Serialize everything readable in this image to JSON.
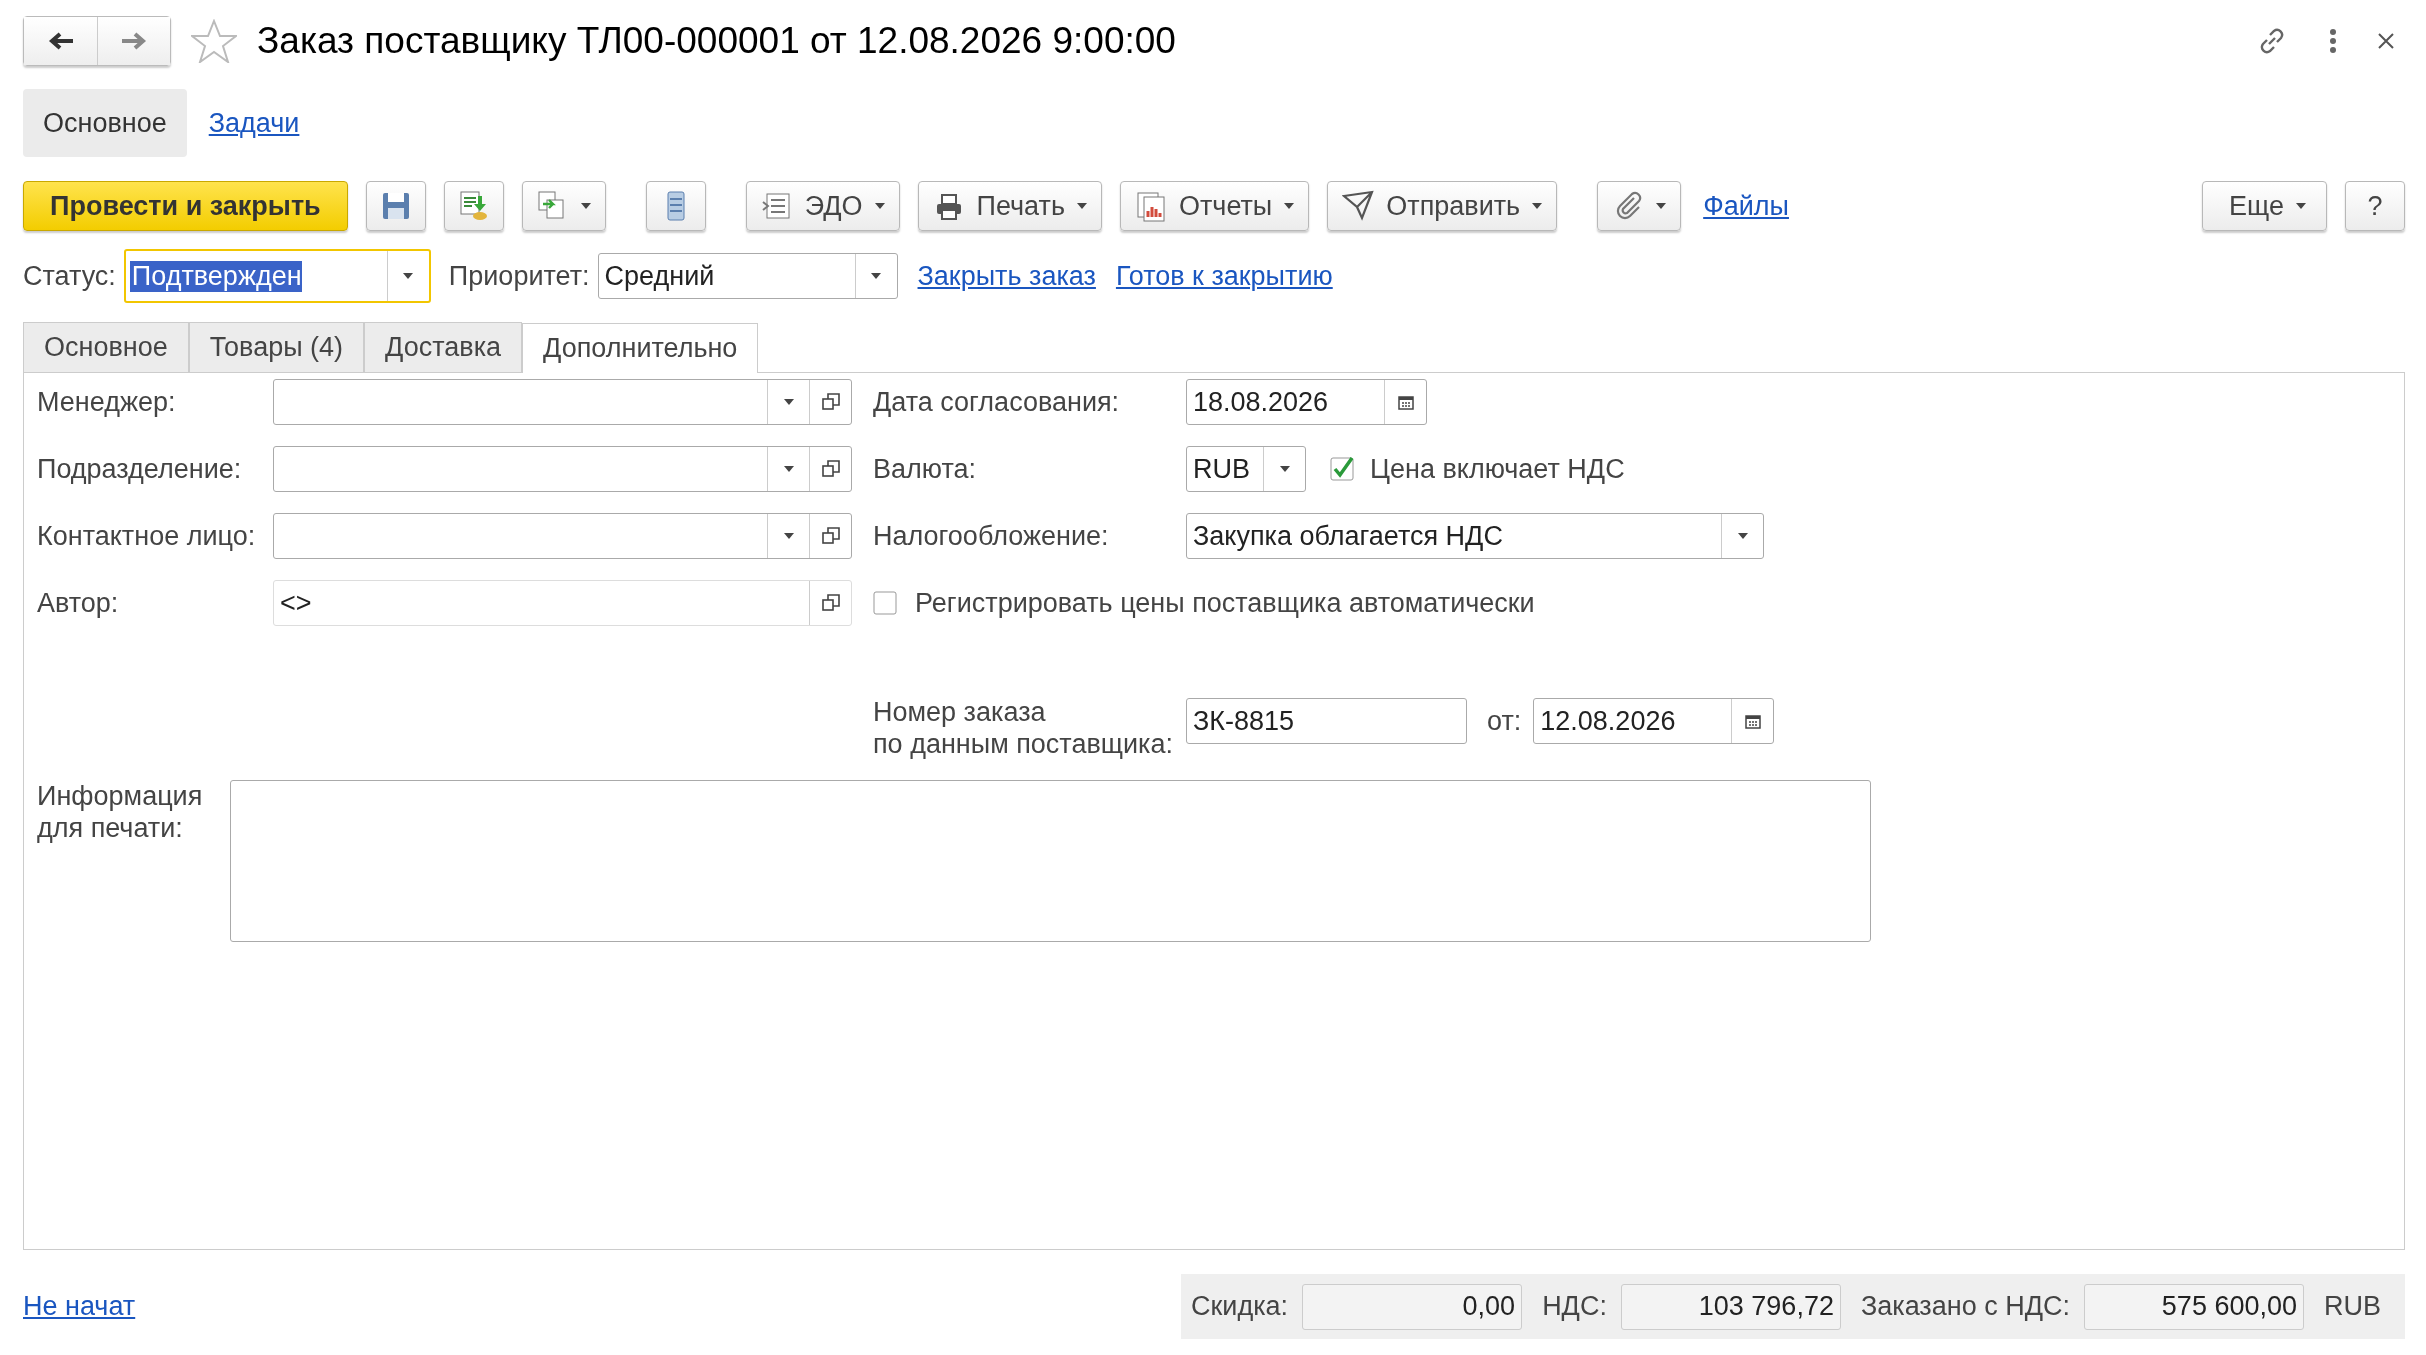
{
  "window": {
    "title": "Заказ поставщику ТЛ00-000001 от 12.08.2026 9:00:00",
    "favorite": false
  },
  "sections": [
    {
      "label": "Основное",
      "selected": true
    },
    {
      "label": "Задачи",
      "selected": false
    }
  ],
  "toolbar": [
    {
      "kind": "primary",
      "label": "Провести и закрыть"
    },
    {
      "kind": "icon"
    },
    {
      "kind": "icon"
    },
    {
      "kind": "icon-menu"
    },
    {
      "kind": "icon",
      "gap": true
    },
    {
      "kind": "menu",
      "label": "ЭДО",
      "gap": true
    },
    {
      "kind": "menu",
      "label": "Печать"
    },
    {
      "kind": "menu",
      "label": "Отчеты"
    },
    {
      "kind": "menu",
      "label": "Отправить"
    },
    {
      "kind": "icon-menu",
      "gap": true
    },
    {
      "kind": "link",
      "label": "Файлы"
    },
    {
      "kind": "menu",
      "label": "Еще",
      "right": true
    },
    {
      "kind": "text",
      "label": "?"
    }
  ],
  "status": {
    "label": "Статус:",
    "value": "Подтвержден",
    "focused": true
  },
  "priority": {
    "label": "Приоритет:",
    "value": "Средний"
  },
  "actions": [
    "Закрыть заказ",
    "Готов к закрытию"
  ],
  "tabs": [
    {
      "label": "Основное",
      "selected": false
    },
    {
      "label": "Товары (4)",
      "selected": false
    },
    {
      "label": "Доставка",
      "selected": false
    },
    {
      "label": "Дополнительно",
      "selected": true
    }
  ],
  "left_fields": [
    {
      "label": "Менеджер:",
      "kind": "select"
    },
    {
      "label": "Подразделение:",
      "kind": "select"
    },
    {
      "label": "Контактное лицо:",
      "kind": "select"
    },
    {
      "label": "Автор:",
      "kind": "readonly",
      "value": "<>"
    }
  ],
  "agreement_date": {
    "label": "Дата согласования:",
    "value": "18.08.2026"
  },
  "currency": {
    "label": "Валюта:",
    "value": "RUB",
    "vat_included": {
      "label": "Цена включает НДС",
      "checked": true
    }
  },
  "taxation": {
    "label": "Налогообложение:",
    "value": "Закупка облагается НДС"
  },
  "auto_register": {
    "label": "Регистрировать цены поставщика автоматически",
    "checked": false
  },
  "supplier_order": {
    "label": "Номер заказа\nпо данным поставщика:",
    "value": "ЗК-8815",
    "date_label": "от:",
    "date": "12.08.2026"
  },
  "print_info": {
    "label": "Информация\nдля печати:"
  },
  "footer": {
    "state_link": "Не начат",
    "totals": [
      {
        "label": "Скидка:",
        "value": "0,00"
      },
      {
        "label": "НДС:",
        "value": "103 796,72"
      },
      {
        "label": "Заказано с НДС:",
        "value": "575 600,00"
      }
    ],
    "currency": "RUB"
  }
}
